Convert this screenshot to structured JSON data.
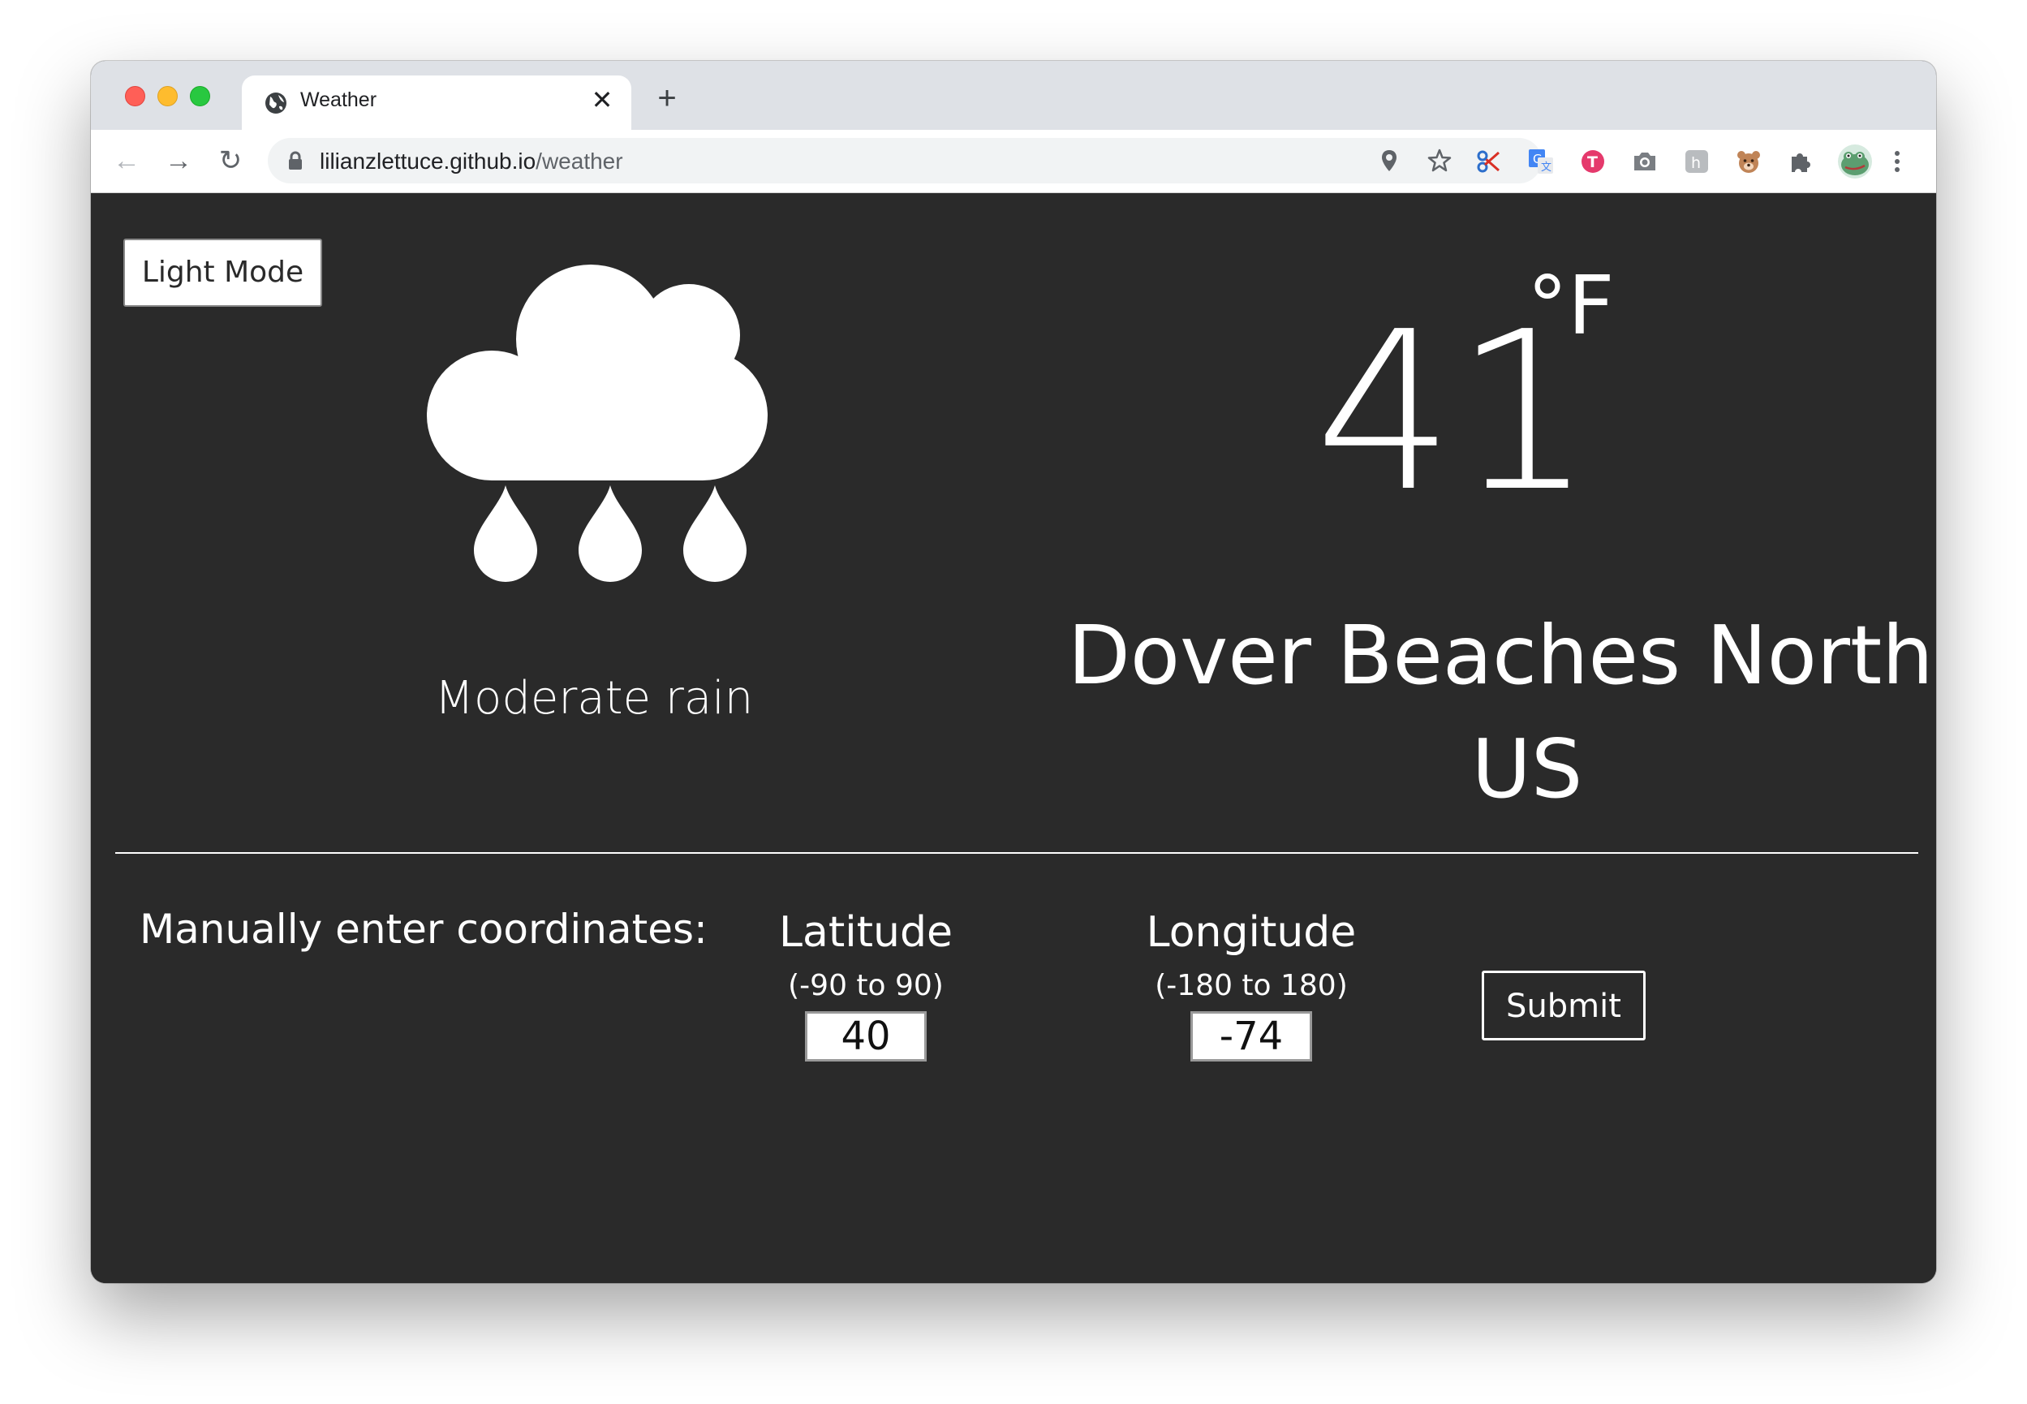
{
  "browser": {
    "tab_title": "Weather",
    "tab_close_glyph": "✕",
    "new_tab_glyph": "+",
    "url_host": "lilianzlettuce.github.io",
    "url_path": "/weather",
    "back_glyph": "←",
    "forward_glyph": "→",
    "reload_glyph": "↻",
    "omnibox_icons": [
      "location-icon",
      "bookmark-star-icon"
    ],
    "extension_icons": [
      "scissors-extension-icon",
      "google-translate-icon",
      "red-t-extension-icon",
      "camera-extension-icon",
      "h-extension-icon",
      "bear-extension-icon",
      "puzzle-extensions-icon",
      "profile-avatar-icon",
      "more-menu-icon"
    ]
  },
  "page": {
    "mode_button_label": "Light Mode",
    "weather_icon": "rain-cloud-icon",
    "condition": "Moderate rain",
    "temperature": "41",
    "unit": "°F",
    "location": "Dover Beaches North / US",
    "manual_label": "Manually enter coordinates:",
    "latitude": {
      "title": "Latitude",
      "range": "(-90 to 90)",
      "value": "40"
    },
    "longitude": {
      "title": "Longitude",
      "range": "(-180 to 180)",
      "value": "-74"
    },
    "submit_label": "Submit"
  },
  "colors": {
    "page_background": "#2a2a2a",
    "text": "#ffffff",
    "tabstrip": "#dee1e6",
    "close_red": "#ff5f57",
    "minimize_yellow": "#febc2e",
    "zoom_green": "#28c840"
  }
}
